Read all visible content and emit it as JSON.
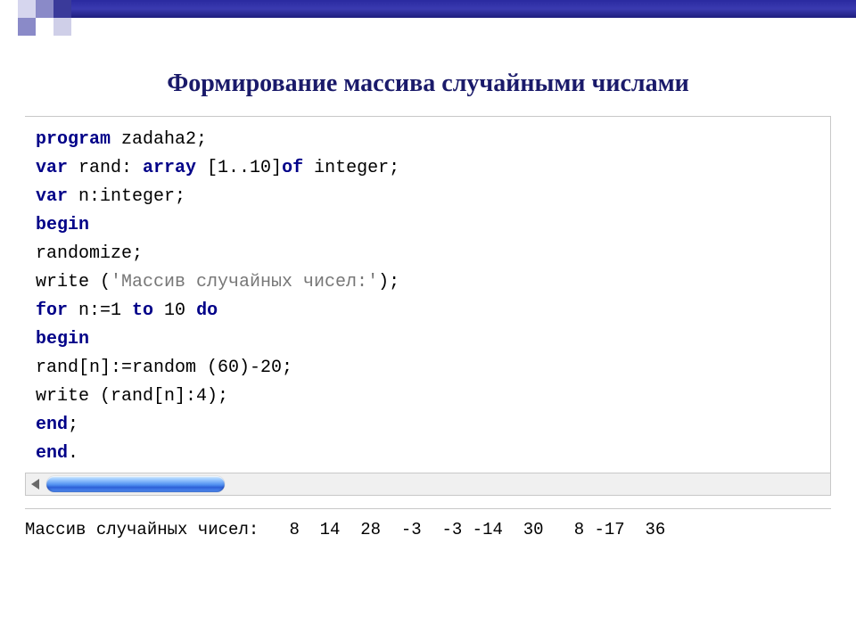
{
  "title": "Формирование массива случайными числами",
  "code": {
    "tokens": [
      [
        {
          "t": "kw",
          "v": "program"
        },
        {
          "t": "id",
          "v": " zadaha2;"
        }
      ],
      [
        {
          "t": "kw",
          "v": "var"
        },
        {
          "t": "id",
          "v": " rand: "
        },
        {
          "t": "kw",
          "v": "array"
        },
        {
          "t": "id",
          "v": " [1..10]"
        },
        {
          "t": "kw",
          "v": "of"
        },
        {
          "t": "id",
          "v": " integer;"
        }
      ],
      [
        {
          "t": "kw",
          "v": "var"
        },
        {
          "t": "id",
          "v": " n:integer;"
        }
      ],
      [
        {
          "t": "kw",
          "v": "begin"
        }
      ],
      [
        {
          "t": "id",
          "v": "randomize;"
        }
      ],
      [
        {
          "t": "id",
          "v": "write ("
        },
        {
          "t": "str",
          "v": "'Массив случайных чисел:'"
        },
        {
          "t": "id",
          "v": ");"
        }
      ],
      [
        {
          "t": "kw",
          "v": "for"
        },
        {
          "t": "id",
          "v": " n:=1 "
        },
        {
          "t": "kw",
          "v": "to"
        },
        {
          "t": "id",
          "v": " 10 "
        },
        {
          "t": "kw",
          "v": "do"
        }
      ],
      [
        {
          "t": "kw",
          "v": "begin"
        }
      ],
      [
        {
          "t": "id",
          "v": "rand[n]:=random (60)-20;"
        }
      ],
      [
        {
          "t": "id",
          "v": "write (rand[n]:4);"
        }
      ],
      [
        {
          "t": "kw",
          "v": "end"
        },
        {
          "t": "id",
          "v": ";"
        }
      ],
      [
        {
          "t": "kw",
          "v": "end"
        },
        {
          "t": "id",
          "v": "."
        }
      ]
    ]
  },
  "output_line": "Массив случайных чисел:   8  14  28  -3  -3 -14  30   8 -17  36"
}
